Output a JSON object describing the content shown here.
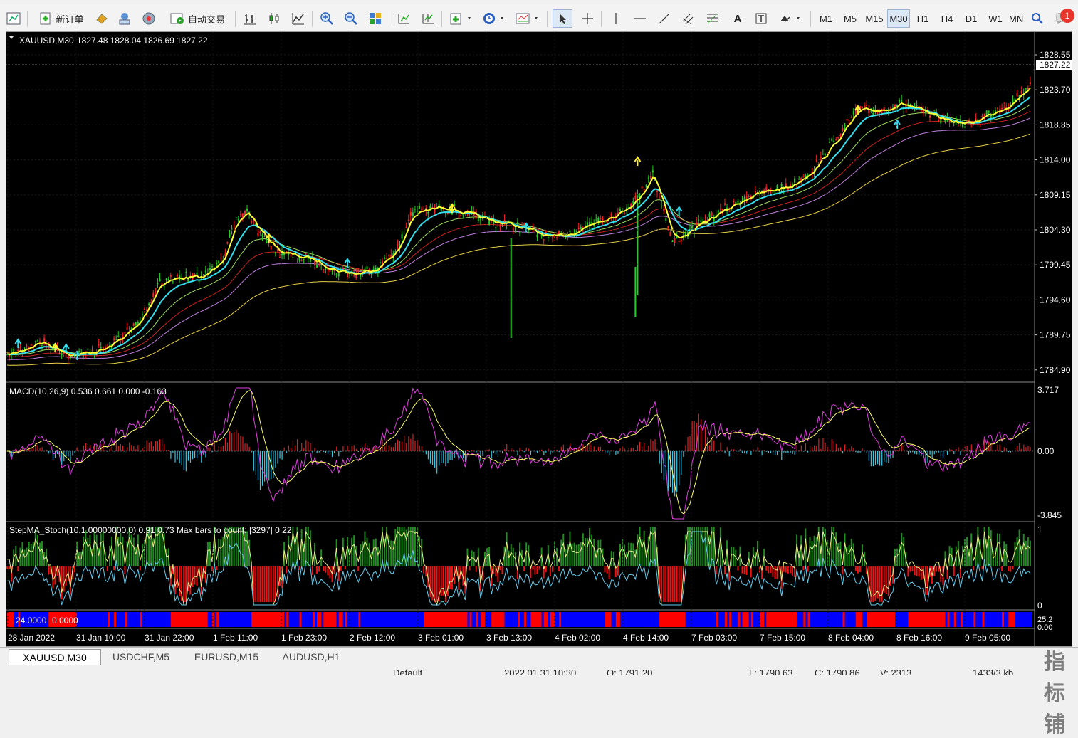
{
  "toolbar": {
    "new_order_label": "新订单",
    "autotrade_label": "自动交易",
    "timeframes": [
      "M1",
      "M5",
      "M15",
      "M30",
      "H1",
      "H4",
      "D1",
      "W1",
      "MN"
    ],
    "active_timeframe": "M30",
    "notification_count": "1"
  },
  "chart": {
    "title": "XAUUSD,M30",
    "ohlc": "1827.48 1828.04 1826.69 1827.22",
    "price_axis": [
      "1828.55",
      "1823.70",
      "1818.85",
      "1814.00",
      "1809.15",
      "1804.30",
      "1799.45",
      "1794.60",
      "1789.75",
      "1784.90"
    ],
    "current_price": "1827.22",
    "time_axis": [
      "28 Jan 2022",
      "31 Jan 10:00",
      "31 Jan 22:00",
      "1 Feb 11:00",
      "1 Feb 23:00",
      "2 Feb 12:00",
      "3 Feb 01:00",
      "3 Feb 13:00",
      "4 Feb 02:00",
      "4 Feb 14:00",
      "7 Feb 03:00",
      "7 Feb 15:00",
      "8 Feb 04:00",
      "8 Feb 16:00",
      "9 Feb 05:00"
    ],
    "macd": {
      "label": "MACD(10,26,9) 0.536 0.661 0.000 -0.163",
      "max": "3.717",
      "zero": "0.00",
      "min": "-3.845"
    },
    "stoch": {
      "label": "StepMA_Stoch(10,1.00000000,0) 0.91 0.73  Max bars to count: |3297|  0.22",
      "max": "1",
      "min": "0"
    },
    "band": {
      "label_a": "24.0000",
      "label_b": "0.0000",
      "axis_a": "25.2",
      "axis_b": "0.00"
    },
    "colors": {
      "bull": "#ff2020",
      "bear": "#22d022",
      "fast_ma": "#ffff33",
      "mid_ma": "#33e0f0",
      "macd_hist_pos": "#dd2020",
      "macd_hist_neg": "#33c8e8",
      "stoch_up": "#1f8c1f",
      "stoch_down": "#ee1111",
      "band_blue": "#0000ff",
      "band_red": "#ff0000"
    }
  },
  "tabs": [
    "XAUUSD,M30",
    "USDCHF,M5",
    "EURUSD,M15",
    "AUDUSD,H1"
  ],
  "status": {
    "profile": "Default",
    "datetime": "2022.01.31 10:30",
    "open": "O: 1791.20",
    "low": "L: 1790.63",
    "close": "C: 1790.86",
    "volume": "V: 2313",
    "traffic": "1433/3 kb"
  }
}
